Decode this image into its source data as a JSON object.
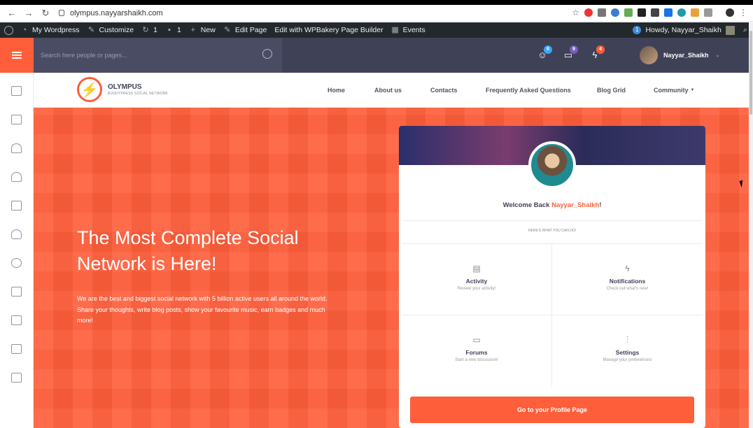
{
  "browser": {
    "url": "olympus.nayyarshaikh.com"
  },
  "wp_admin_bar": {
    "items": [
      "My Wordpress",
      "Customize",
      "1",
      "1",
      "New",
      "Edit Page",
      "Edit with WPBakery Page Builder",
      "Events"
    ],
    "notif_count": "1",
    "howdy": "Howdy, Nayyar_Shaikh"
  },
  "header": {
    "search_placeholder": "Search here people or pages...",
    "badges": [
      "6",
      "9",
      "4"
    ],
    "badge_colors": [
      "#38a9ff",
      "#7c5ac2",
      "#ff5e3a"
    ],
    "username": "Nayyar_Shaikh"
  },
  "site": {
    "logo_name": "OLYMPUS",
    "logo_tagline": "BUDDYPRESS SOCIAL NETWORK",
    "menu": [
      "Home",
      "About us",
      "Contacts",
      "Frequently Asked Questions",
      "Blog Grid",
      "Community"
    ]
  },
  "hero": {
    "title": "The Most Complete Social Network is Here!",
    "text": "We are the best and biggest social network with 5 billion active users all around the world. Share your thoughts, write blog posts, show your favourite music, earn badges and much more!",
    "accent_color": "#ff5e3a"
  },
  "card": {
    "welcome_prefix": "Welcome Back ",
    "welcome_name": "Nayyar_Shaikh",
    "welcome_suffix": "!",
    "subtitle": "HERE'S WHAT YOU CAN DO!",
    "actions": [
      {
        "title": "Activity",
        "sub": "Review your activity!"
      },
      {
        "title": "Notifications",
        "sub": "Check out what's new!"
      },
      {
        "title": "Forums",
        "sub": "Start a new discussion!"
      },
      {
        "title": "Settings",
        "sub": "Manage your preferences!"
      }
    ],
    "button": "Go to your Profile Page"
  }
}
